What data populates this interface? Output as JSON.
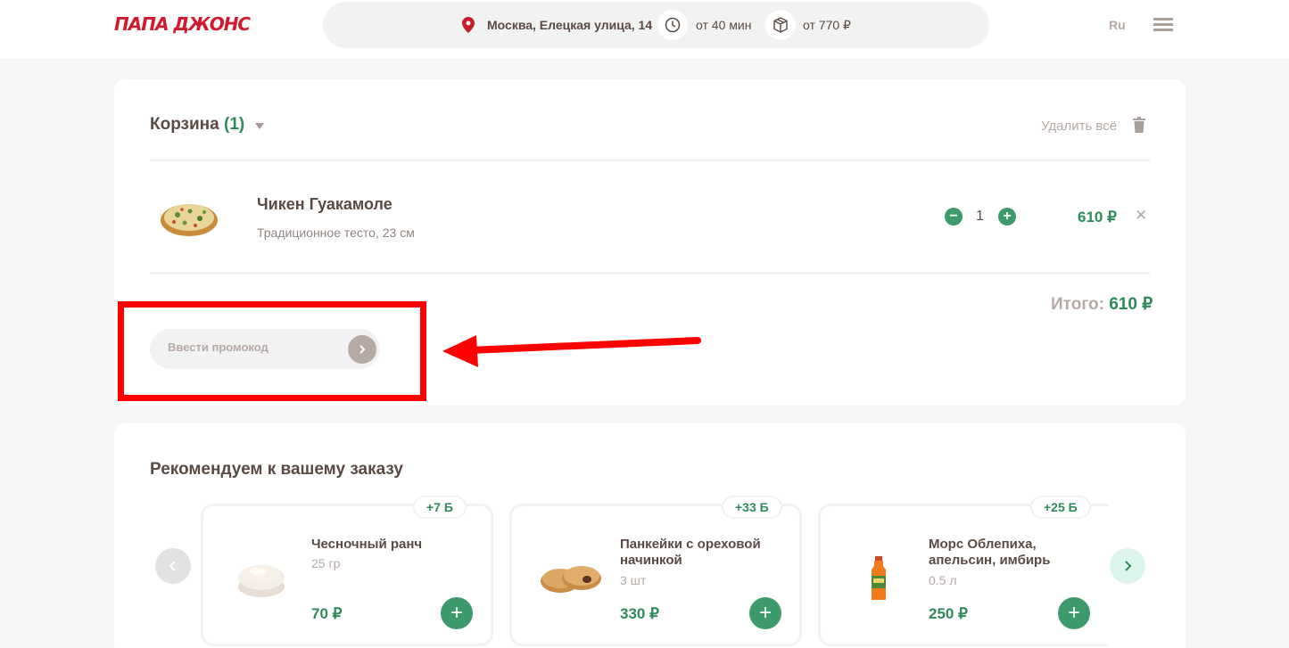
{
  "header": {
    "logo": "ПАПА ДЖОНС",
    "address": "Москва, Елецкая улица, 14",
    "delivery_time": "от 40 мин",
    "min_order": "от 770 ₽",
    "language": "Ru"
  },
  "cart": {
    "title": "Корзина",
    "count": "(1)",
    "clear_all": "Удалить всё",
    "items": [
      {
        "name": "Чикен Гуакамоле",
        "description": "Традиционное тесто, 23 см",
        "quantity": "1",
        "price": "610 ₽"
      }
    ],
    "total_label": "Итого:",
    "total_value": "610 ₽",
    "promo_placeholder": "Ввести промокод"
  },
  "recommendations": {
    "title": "Рекомендуем к вашему заказу",
    "items": [
      {
        "name": "Чесночный ранч",
        "size": "25 гр",
        "price": "70 ₽",
        "bonus": "+7 Б"
      },
      {
        "name": "Панкейки с ореховой начинкой",
        "size": "3 шт",
        "price": "330 ₽",
        "bonus": "+33 Б"
      },
      {
        "name": "Морс Облепиха, апельсин, имбирь",
        "size": "0.5 л",
        "price": "250 ₽",
        "bonus": "+25 Б"
      }
    ]
  },
  "icons": [
    "location-pin-icon",
    "clock-icon",
    "box-icon",
    "menu-icon",
    "trash-icon",
    "close-icon",
    "chevron-left-icon",
    "chevron-right-icon",
    "plus-icon",
    "minus-icon"
  ],
  "colors": {
    "brand_red": "#d21a2e",
    "accent_green": "#2e8a5a",
    "annotation_red": "#ff0000"
  }
}
